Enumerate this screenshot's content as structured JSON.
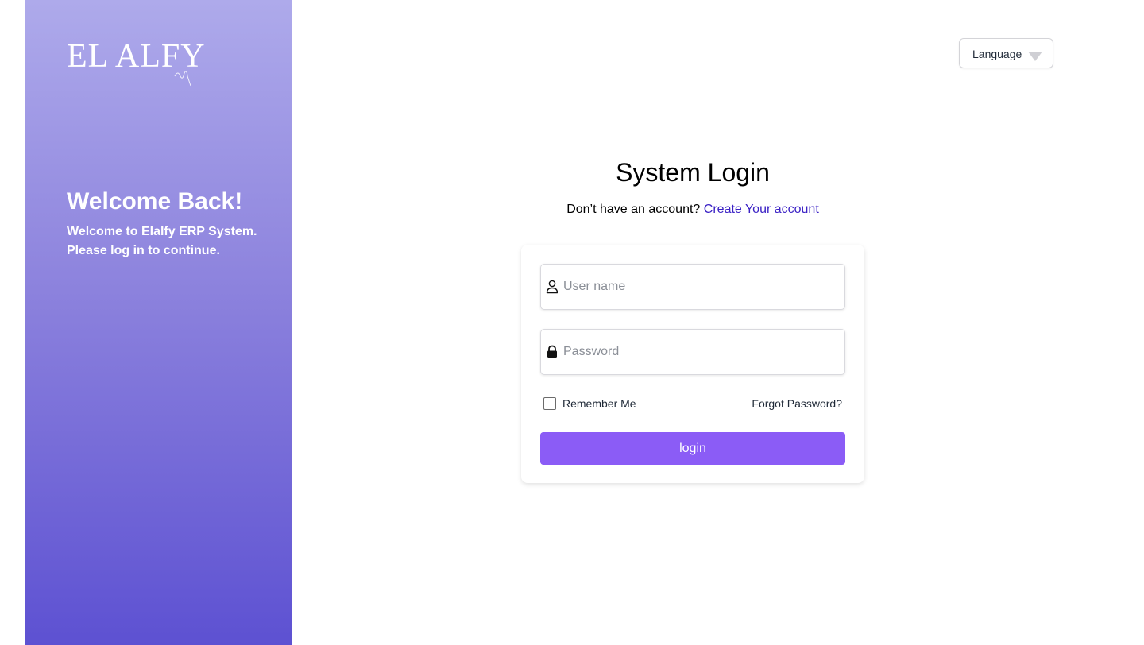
{
  "brand": {
    "logo_text": "EL ALFY"
  },
  "side_panel": {
    "title": "Welcome Back!",
    "message": "Welcome to Elalfy ERP System. Please log in to continue."
  },
  "language": {
    "label": "Language"
  },
  "login": {
    "title": "System Login",
    "signup_prompt": "Don’t have an account?",
    "signup_link": "Create Your account",
    "username_placeholder": "User name",
    "username_value": "",
    "password_placeholder": "Password",
    "password_value": "",
    "remember_label": "Remember Me",
    "remember_checked": false,
    "forgot_label": "Forgot Password?",
    "submit_label": "login"
  },
  "icons": {
    "username": "user-icon",
    "password": "lock-icon",
    "language": "chevron-down-icon"
  },
  "colors": {
    "panel_gradient_top": "#aeaaeb",
    "panel_gradient_bottom": "#5d51d2",
    "accent": "#8b5cf6",
    "link": "#3b22c5"
  }
}
